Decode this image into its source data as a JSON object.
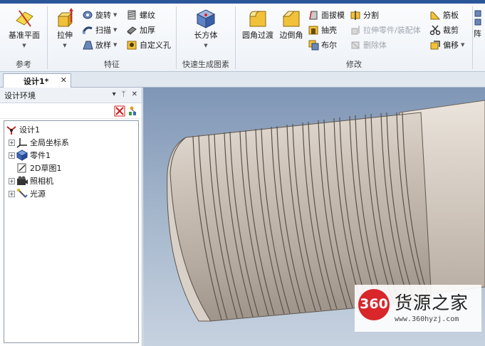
{
  "ribbon": {
    "groups": {
      "reference": {
        "label": "参考",
        "datum_plane": "基准平面"
      },
      "features": {
        "label": "特征",
        "extrude": "拉伸",
        "revolve": "旋转",
        "sweep": "扫描",
        "loft": "放样",
        "thread": "螺纹",
        "thicken": "加厚",
        "custom_hole": "自定义孔"
      },
      "quick_shape": {
        "label": "快速生成图素",
        "box": "长方体"
      },
      "modify": {
        "label": "修改",
        "fillet": "圆角过渡",
        "chamfer": "边倒角",
        "draft": "面拔模",
        "shell": "抽壳",
        "boolean": "布尔",
        "split": "分割",
        "extrude_part": "拉伸零件/装配体",
        "delete_body": "删除体",
        "rib": "筋板",
        "trim": "裁剪",
        "offset": "偏移"
      },
      "array_partial": "阵"
    }
  },
  "document_tab": {
    "title": "设计1*",
    "close": "✕"
  },
  "panel": {
    "title": "设计环境",
    "pin": "▾",
    "autohide": "ᛘ",
    "close": "✕",
    "tree": [
      {
        "label": "设计1",
        "expander": ""
      },
      {
        "label": "全局坐标系",
        "expander": "+"
      },
      {
        "label": "零件1",
        "expander": "+"
      },
      {
        "label": "2D草图1",
        "expander": ""
      },
      {
        "label": "照相机",
        "expander": "+"
      },
      {
        "label": "光源",
        "expander": "+"
      }
    ]
  },
  "watermark": {
    "logo": "360",
    "name": "货源之家",
    "url": "www.360hyzj.com"
  },
  "colors": {
    "accent": "#2b579a",
    "logo_red": "#d8262b",
    "part_metal": "#c8bdb2"
  }
}
